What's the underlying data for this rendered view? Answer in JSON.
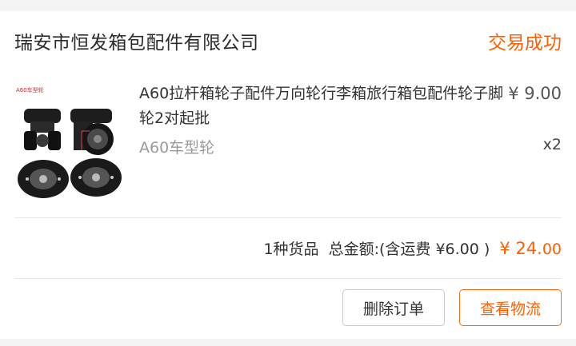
{
  "order": {
    "shop_name": "瑞安市恒发箱包配件有限公司",
    "status": "交易成功"
  },
  "product": {
    "image_caption": "A60车型轮",
    "title": "A60拉杆箱轮子配件万向轮行李箱旅行箱包配件轮子脚轮2对起批",
    "spec": "A60车型轮",
    "price": "¥ 9.00",
    "quantity": "x2"
  },
  "summary": {
    "item_count_label": "1种货品",
    "total_label": "总金额:",
    "shipping_note": "(含运费 ¥6.00 )",
    "total_prefix": "¥ 24.",
    "total_cents": "00"
  },
  "actions": {
    "delete_label": "删除订单",
    "logistics_label": "查看物流"
  },
  "colors": {
    "accent": "#ff5f00",
    "background": "#f4f4f4"
  }
}
